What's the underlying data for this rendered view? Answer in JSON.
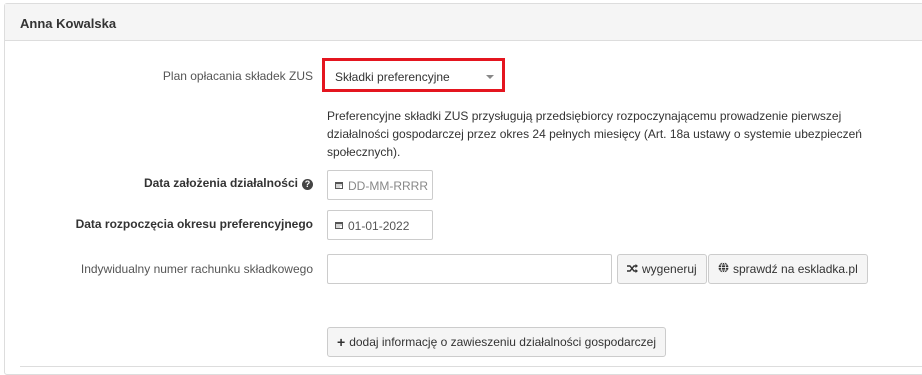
{
  "panel": {
    "title": "Anna Kowalska"
  },
  "plan": {
    "label": "Plan opłacania składek ZUS",
    "selected": "Składki preferencyjne",
    "info": "Preferencyjne składki ZUS przysługują przedsiębiorcy rozpoczynającemu prowadzenie pierwszej działalności gospodarczej przez okres 24 pełnych miesięcy (Art. 18a ustawy o systemie ubezpieczeń społecznych)."
  },
  "founding_date": {
    "label": "Data założenia działalności",
    "placeholder": "DD-MM-RRRR"
  },
  "pref_start_date": {
    "label": "Data rozpoczęcia okresu preferencyjnego",
    "value": "01-01-2022"
  },
  "account": {
    "label": "Indywidualny numer rachunku składkowego",
    "value": "",
    "generate_label": "wygeneruj",
    "check_label": "sprawdź na eskladka.pl"
  },
  "suspension": {
    "button_label": "dodaj informację o zawieszeniu działalności gospodarczej"
  },
  "colors": {
    "highlight": "#e4151f",
    "heading_bg": "#f5f5f5",
    "border": "#dddddd"
  },
  "icons": [
    "calendar-icon",
    "question-circle-icon",
    "shuffle-icon",
    "globe-icon",
    "plus-icon",
    "chevron-down-icon"
  ]
}
